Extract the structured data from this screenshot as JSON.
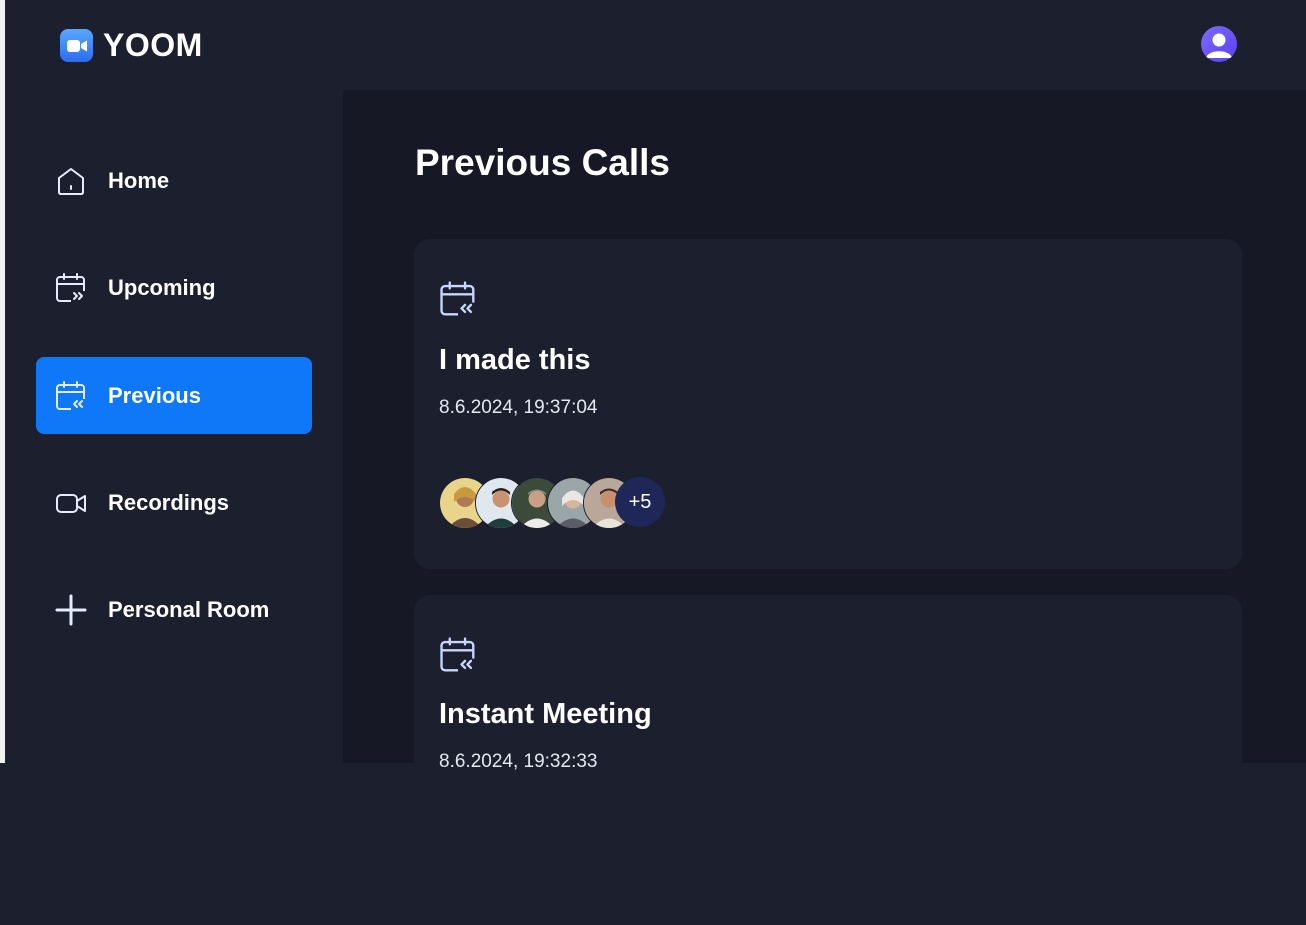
{
  "app": {
    "name": "YOOM"
  },
  "sidebar": {
    "items": [
      {
        "label": "Home",
        "icon": "home-icon",
        "active": false
      },
      {
        "label": "Upcoming",
        "icon": "calendar-forward-icon",
        "active": false
      },
      {
        "label": "Previous",
        "icon": "calendar-back-icon",
        "active": true
      },
      {
        "label": "Recordings",
        "icon": "video-icon",
        "active": false
      },
      {
        "label": "Personal Room",
        "icon": "plus-icon",
        "active": false
      }
    ]
  },
  "main": {
    "title": "Previous Calls",
    "calls": [
      {
        "title": "I made this",
        "date": "8.6.2024, 19:37:04",
        "extra_attendees": "+5"
      },
      {
        "title": "Instant Meeting",
        "date": "8.6.2024, 19:32:33"
      }
    ]
  },
  "colors": {
    "accent": "#0e78f9",
    "background": "#1c1f2e",
    "main_background": "#161925",
    "card": "#1c1f2e"
  }
}
